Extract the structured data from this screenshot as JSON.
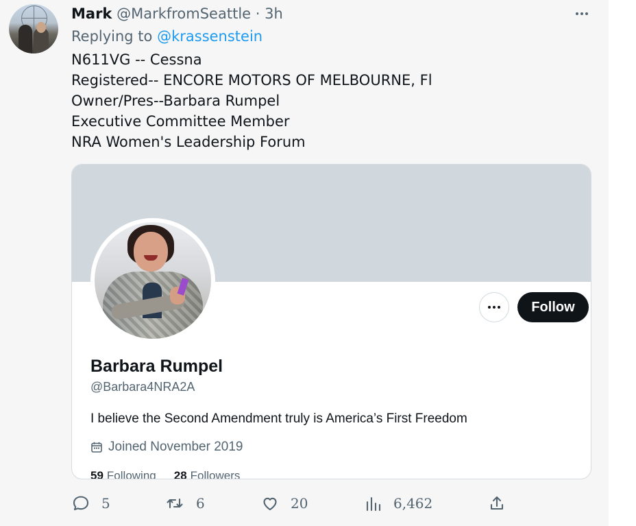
{
  "tweet": {
    "author": {
      "name": "Mark",
      "handle": "@MarkfromSeattle",
      "separator": "·",
      "time": "3h"
    },
    "replying_label": "Replying to",
    "replying_to": "@krassenstein",
    "text_lines": [
      "N611VG -- Cessna",
      "Registered-- ENCORE MOTORS OF MELBOURNE, Fl",
      "Owner/Pres--Barbara Rumpel",
      "Executive Committee Member",
      "NRA Women's Leadership Forum"
    ],
    "menu_icon": "more-horizontal-icon"
  },
  "profile_card": {
    "follow_label": "Follow",
    "name": "Barbara Rumpel",
    "handle": "@Barbara4NRA2A",
    "bio": "I believe the Second Amendment truly is America’s First Freedom",
    "joined": "Joined November 2019",
    "following_count": "59",
    "following_label": "Following",
    "followers_count": "28",
    "followers_label": "Followers",
    "icons": {
      "more": "more-horizontal-icon",
      "joined": "calendar-icon"
    }
  },
  "actions": {
    "reply_count": "5",
    "retweet_count": "6",
    "like_count": "20",
    "views_count": "6,462"
  },
  "colors": {
    "background": "#f6f6f6",
    "text": "#0f1419",
    "secondary_text": "#536471",
    "link": "#1d9bf0",
    "banner": "#d0d8de",
    "follow_button": "#0f1419"
  }
}
